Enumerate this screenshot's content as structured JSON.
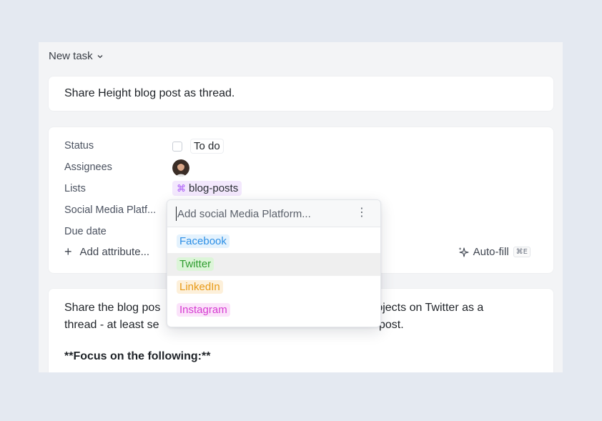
{
  "header": {
    "title": "New task"
  },
  "task": {
    "title": "Share Height blog post as thread."
  },
  "attributes": {
    "status": {
      "label": "Status",
      "value": "To do"
    },
    "assignees": {
      "label": "Assignees"
    },
    "lists": {
      "label": "Lists",
      "value": "blog-posts",
      "icon": "command-icon",
      "glyph": "⌘"
    },
    "social": {
      "label": "Social Media Platf..."
    },
    "due_date": {
      "label": "Due date"
    },
    "add_attribute": "Add attribute...",
    "autofill": {
      "label": "Auto-fill",
      "shortcut": "⌘E"
    }
  },
  "dropdown": {
    "placeholder": "Add social Media Platform...",
    "more_glyph": "⋮",
    "options": [
      {
        "label": "Facebook",
        "color": "#2d8fe6",
        "bg": "#e4f2fd"
      },
      {
        "label": "Twitter",
        "color": "#2f9d2f",
        "bg": "#dcf5d8"
      },
      {
        "label": "LinkedIn",
        "color": "#e89a16",
        "bg": "#fdf0da"
      },
      {
        "label": "Instagram",
        "color": "#d63bd1",
        "bg": "#fbe3fa"
      }
    ],
    "hovered_index": 1
  },
  "description": {
    "line1_left": "Share the blog pos",
    "line1_right": "rojects on Twitter as a",
    "line2_left": "thread - at least se",
    "line2_right": "post.",
    "bold": "**Focus on the following:**"
  },
  "colors": {
    "background": "#e4e9f1",
    "panel": "#f3f4f6",
    "list_pill_bg": "#f3e8fd",
    "hover": "#efefef"
  }
}
